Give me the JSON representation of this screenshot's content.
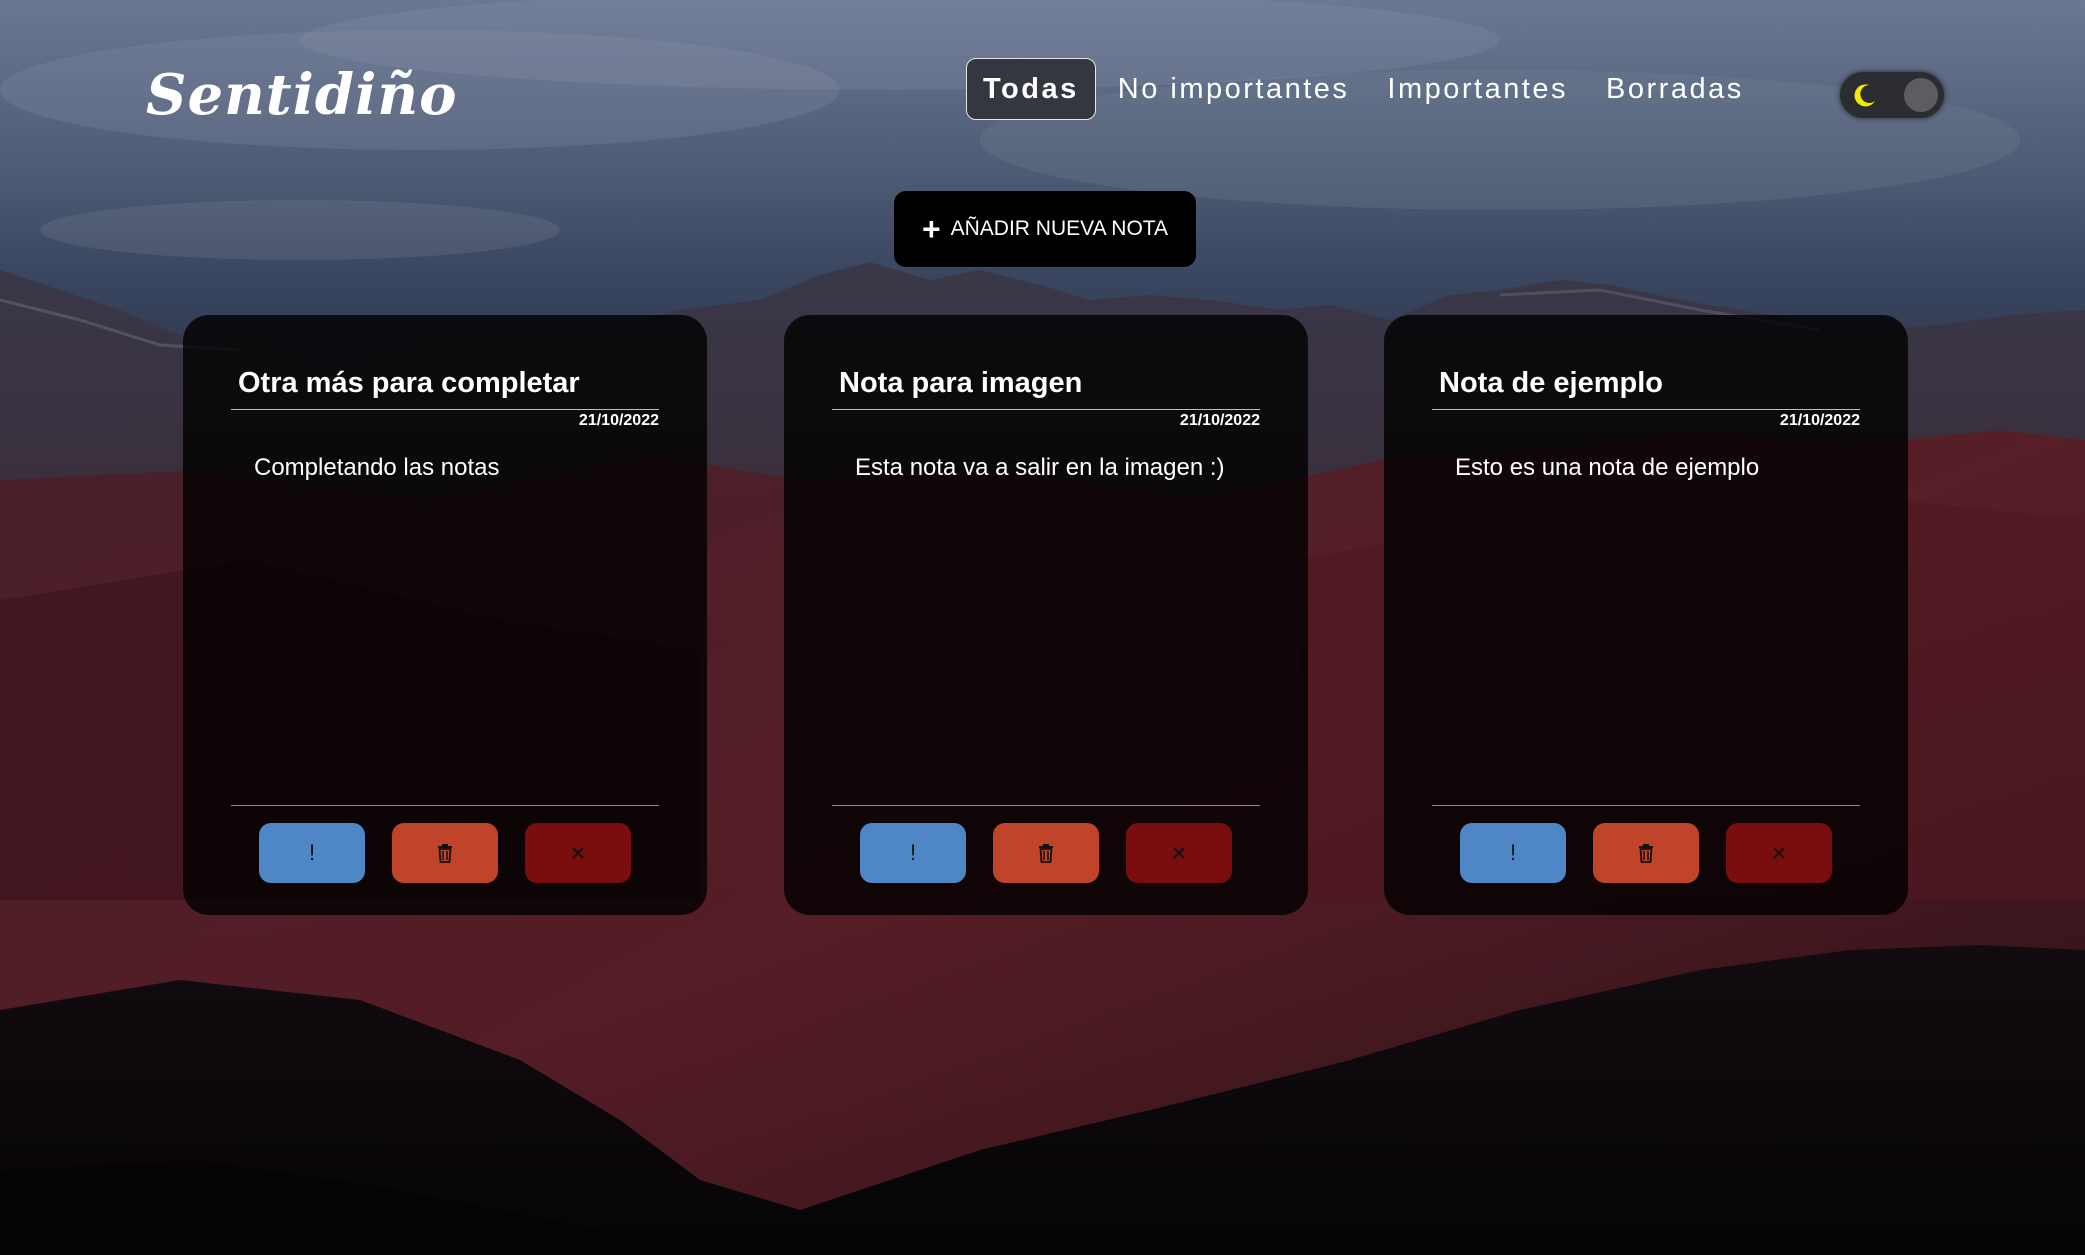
{
  "app": {
    "logo": "Sentidiño"
  },
  "nav": {
    "items": [
      {
        "label": "Todas",
        "active": true
      },
      {
        "label": "No importantes",
        "active": false
      },
      {
        "label": "Importantes",
        "active": false
      },
      {
        "label": "Borradas",
        "active": false
      }
    ]
  },
  "theme_toggle": {
    "icon": "moon-icon",
    "state": "dark"
  },
  "add_note": {
    "label": "AÑADIR NUEVA NOTA",
    "icon": "plus-icon"
  },
  "notes": [
    {
      "title": "Otra más para completar",
      "date": "21/10/2022",
      "body": "Completando las notas"
    },
    {
      "title": "Nota para imagen",
      "date": "21/10/2022",
      "body": "Esta nota va a salir en la imagen :)"
    },
    {
      "title": "Nota de ejemplo",
      "date": "21/10/2022",
      "body": "Esto es una nota de ejemplo"
    }
  ],
  "note_actions": {
    "important_label": "!",
    "trash_icon": "trash-icon",
    "delete_icon": "close-icon"
  },
  "colors": {
    "important": "#4f86c6",
    "trash": "#c0442a",
    "delete": "#7a0d0d",
    "card_bg": "rgba(0,0,0,0.80)",
    "moon": "#f5e900"
  }
}
